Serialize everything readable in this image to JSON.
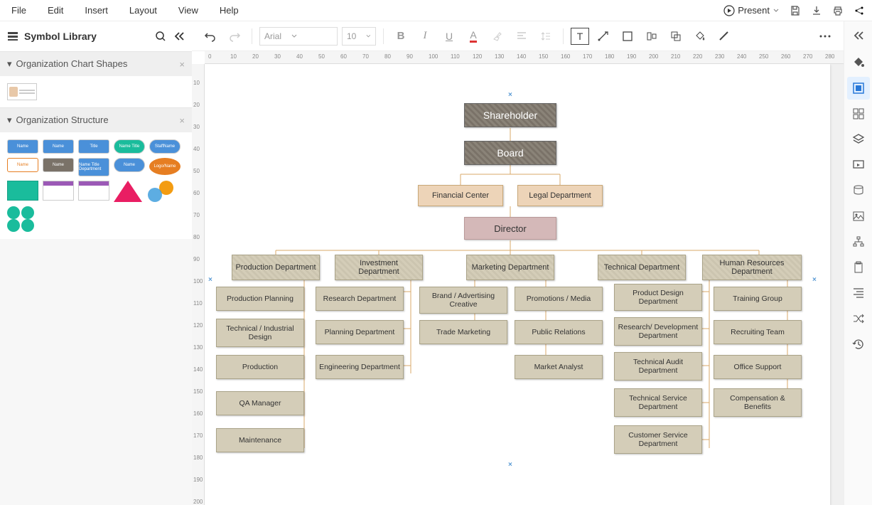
{
  "menu": {
    "file": "File",
    "edit": "Edit",
    "insert": "Insert",
    "layout": "Layout",
    "view": "View",
    "help": "Help",
    "present": "Present"
  },
  "sidebar": {
    "title": "Symbol Library",
    "sections": [
      {
        "title": "Organization Chart Shapes"
      },
      {
        "title": "Organization Structure"
      }
    ],
    "thumbs_row1": [
      "Name",
      "Name",
      "Title",
      "Name Title",
      "StaffName"
    ],
    "thumbs_row2": [
      "Name",
      "Name",
      "Name Title Department",
      "Name",
      "Logo/Name"
    ]
  },
  "toolbar": {
    "font": "Arial",
    "size": "10"
  },
  "ruler_h": [
    0,
    10,
    20,
    30,
    40,
    50,
    60,
    70,
    80,
    90,
    100,
    110,
    120,
    130,
    140,
    150,
    160,
    170,
    180,
    190,
    200,
    210,
    220,
    230,
    240,
    250,
    260,
    270,
    280
  ],
  "ruler_v": [
    10,
    20,
    30,
    40,
    50,
    60,
    70,
    80,
    90,
    100,
    110,
    120,
    130,
    140,
    150,
    160,
    170,
    180,
    190,
    200
  ],
  "org": {
    "top1": "Shareholder",
    "top2": "Board",
    "lvl3a": "Financial Center",
    "lvl3b": "Legal Department",
    "director": "Director",
    "depts": [
      "Production Department",
      "Investment Department",
      "Marketing Department",
      "Technical Department",
      "Human Resources Department"
    ],
    "col0": [
      "Production Planning",
      "Technical / Industrial Design",
      "Production",
      "QA Manager",
      "Maintenance"
    ],
    "col1": [
      "Research Department",
      "Planning Department",
      "Engineering Department"
    ],
    "col2": [
      "Brand / Advertising Creative",
      "Trade Marketing"
    ],
    "col3": [
      "Promotions / Media",
      "Public Relations",
      "Market Analyst"
    ],
    "col4": [
      "Product Design Department",
      "Research/ Development Department",
      "Technical Audit Department",
      "Technical Service Department",
      "Customer Service Department"
    ],
    "col5": [
      "Training Group",
      "Recruiting Team",
      "Office Support",
      "Compensation & Benefits"
    ]
  }
}
